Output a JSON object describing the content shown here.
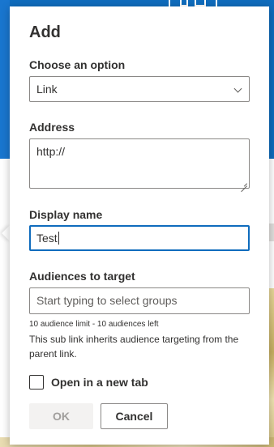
{
  "dialog": {
    "title": "Add",
    "option": {
      "label": "Choose an option",
      "selected": "Link"
    },
    "address": {
      "label": "Address",
      "value": "http://"
    },
    "display_name": {
      "label": "Display name",
      "value": "Test"
    },
    "audiences": {
      "label": "Audiences to target",
      "placeholder": "Start typing to select groups",
      "limit_text": "10 audience limit - 10 audiences left",
      "inherit_text": "This sub link inherits audience targeting from the parent link."
    },
    "new_tab": {
      "label": "Open in a new tab",
      "checked": false
    },
    "buttons": {
      "ok": "OK",
      "cancel": "Cancel"
    }
  },
  "colors": {
    "brand_blue": "#0f6cbd",
    "focus_border": "#0f6cbd",
    "text_primary": "#323130",
    "disabled_button_bg": "#f3f2f1"
  },
  "icons": {
    "dropdown": "chevron-down-icon",
    "resize": "resize-grip-icon"
  }
}
